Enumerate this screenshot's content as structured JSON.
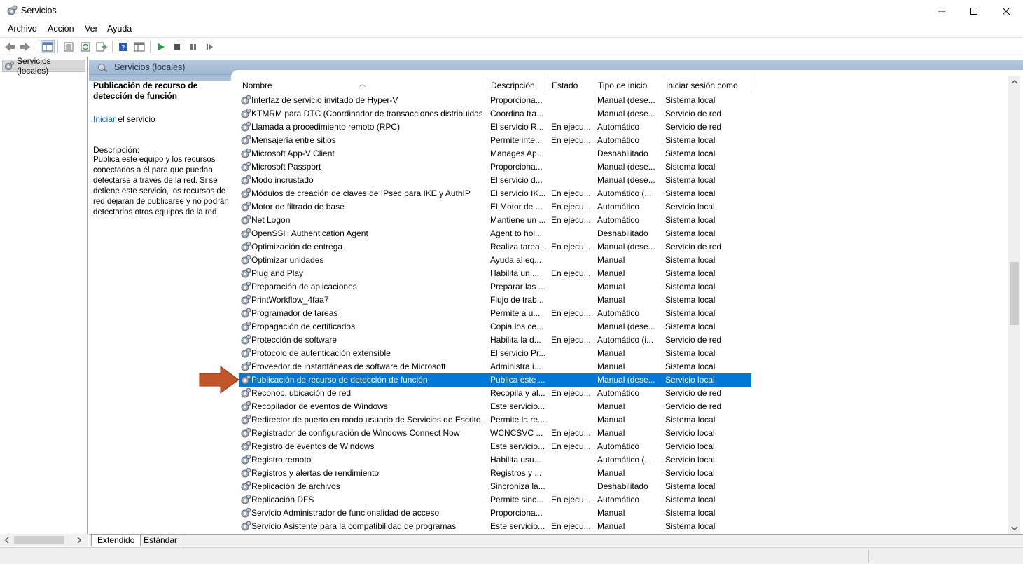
{
  "window": {
    "title": "Servicios"
  },
  "menu": [
    "Archivo",
    "Acción",
    "Ver",
    "Ayuda"
  ],
  "tree": {
    "root_label": "Servicios (locales)"
  },
  "header": {
    "label": "Servicios (locales)"
  },
  "details": {
    "title": "Publicación de recurso de detección de función",
    "start_link": "Iniciar",
    "start_suffix": " el servicio",
    "desc_label": "Descripción:",
    "desc_text": "Publica este equipo y los recursos conectados a él para que puedan detectarse a través de la red. Si se detiene este servicio, los recursos de red dejarán de publicarse y no podrán detectarlos otros equipos de la red."
  },
  "columns": [
    "Nombre",
    "Descripción",
    "Estado",
    "Tipo de inicio",
    "Iniciar sesión como"
  ],
  "rows": [
    [
      "Interfaz de servicio invitado de Hyper-V",
      "Proporciona...",
      "",
      "Manual (dese...",
      "Sistema local"
    ],
    [
      "KTMRM para DTC (Coordinador de transacciones distribuidas)",
      "Coordina tra...",
      "",
      "Manual (dese...",
      "Servicio de red"
    ],
    [
      "Llamada a procedimiento remoto (RPC)",
      "El servicio R...",
      "En ejecu...",
      "Automático",
      "Servicio de red"
    ],
    [
      "Mensajería entre sitios",
      "Permite inte...",
      "En ejecu...",
      "Automático",
      "Sistema local"
    ],
    [
      "Microsoft App-V Client",
      "Manages Ap...",
      "",
      "Deshabilitado",
      "Sistema local"
    ],
    [
      "Microsoft Passport",
      "Proporciona...",
      "",
      "Manual (dese...",
      "Sistema local"
    ],
    [
      "Modo incrustado",
      "El servicio d...",
      "",
      "Manual (dese...",
      "Sistema local"
    ],
    [
      "Módulos de creación de claves de IPsec para IKE y AuthIP",
      "El servicio IK...",
      "En ejecu...",
      "Automático (...",
      "Sistema local"
    ],
    [
      "Motor de filtrado de base",
      "El Motor de ...",
      "En ejecu...",
      "Automático",
      "Servicio local"
    ],
    [
      "Net Logon",
      "Mantiene un ...",
      "En ejecu...",
      "Automático",
      "Sistema local"
    ],
    [
      "OpenSSH Authentication Agent",
      "Agent to hol...",
      "",
      "Deshabilitado",
      "Sistema local"
    ],
    [
      "Optimización de entrega",
      "Realiza tarea...",
      "En ejecu...",
      "Manual (dese...",
      "Servicio de red"
    ],
    [
      "Optimizar unidades",
      "Ayuda al eq...",
      "",
      "Manual",
      "Sistema local"
    ],
    [
      "Plug and Play",
      "Habilita un ...",
      "En ejecu...",
      "Manual",
      "Sistema local"
    ],
    [
      "Preparación de aplicaciones",
      "Preparar las ...",
      "",
      "Manual",
      "Sistema local"
    ],
    [
      "PrintWorkflow_4faa7",
      "Flujo de trab...",
      "",
      "Manual",
      "Sistema local"
    ],
    [
      "Programador de tareas",
      "Permite a u...",
      "En ejecu...",
      "Automático",
      "Sistema local"
    ],
    [
      "Propagación de certificados",
      "Copia los ce...",
      "",
      "Manual (dese...",
      "Sistema local"
    ],
    [
      "Protección de software",
      "Habilita la d...",
      "En ejecu...",
      "Automático (i...",
      "Servicio de red"
    ],
    [
      "Protocolo de autenticación extensible",
      "El servicio Pr...",
      "",
      "Manual",
      "Sistema local"
    ],
    [
      "Proveedor de instantáneas de software de Microsoft",
      "Administra i...",
      "",
      "Manual",
      "Sistema local"
    ],
    [
      "Publicación de recurso de detección de función",
      "Publica este ...",
      "",
      "Manual (dese...",
      "Servicio local"
    ],
    [
      "Reconoc. ubicación de red",
      "Recopila y al...",
      "En ejecu...",
      "Automático",
      "Servicio de red"
    ],
    [
      "Recopilador de eventos de Windows",
      "Este servicio...",
      "",
      "Manual",
      "Servicio de red"
    ],
    [
      "Redirector de puerto en modo usuario de Servicios de Escrito...",
      "Permite la re...",
      "",
      "Manual",
      "Sistema local"
    ],
    [
      "Registrador de configuración de Windows Connect Now",
      "WCNCSVC ...",
      "En ejecu...",
      "Manual",
      "Servicio local"
    ],
    [
      "Registro de eventos de Windows",
      "Este servicio...",
      "En ejecu...",
      "Automático",
      "Servicio local"
    ],
    [
      "Registro remoto",
      "Habilita usu...",
      "",
      "Automático (...",
      "Servicio local"
    ],
    [
      "Registros y alertas de rendimiento",
      "Registros y ...",
      "",
      "Manual",
      "Servicio local"
    ],
    [
      "Replicación de archivos",
      "Sincroniza la...",
      "",
      "Deshabilitado",
      "Sistema local"
    ],
    [
      "Replicación DFS",
      "Permite sinc...",
      "En ejecu...",
      "Automático",
      "Sistema local"
    ],
    [
      "Servicio Administrador de funcionalidad de acceso",
      "Proporciona...",
      "",
      "Manual",
      "Sistema local"
    ],
    [
      "Servicio Asistente para la compatibilidad de programas",
      "Este servicio...",
      "En ejecu...",
      "Manual",
      "Sistema local"
    ]
  ],
  "selected_row": 21,
  "tabs": [
    "Extendido",
    "Estándar"
  ],
  "colors": {
    "selection": "#0078d7",
    "arrow": "#c0562a",
    "header": "#a9bfd8"
  }
}
